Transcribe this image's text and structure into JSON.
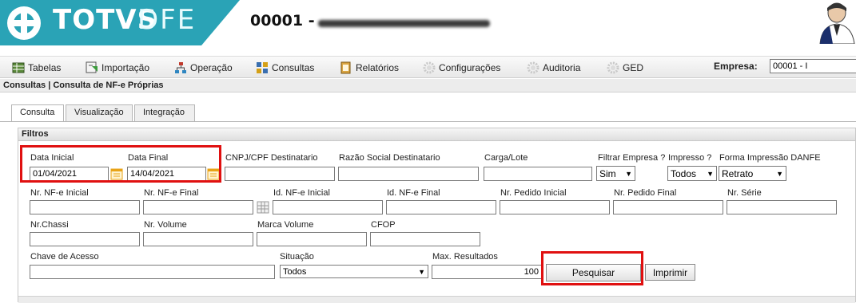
{
  "header": {
    "brand_name": "TOTVS",
    "brand_sub": "DFE",
    "company_title": "00001 - ",
    "brand_color": "#2aa3b6"
  },
  "menu": {
    "items": [
      {
        "label": "Tabelas",
        "icon": "table-icon"
      },
      {
        "label": "Importação",
        "icon": "import-icon"
      },
      {
        "label": "Operação",
        "icon": "operation-icon"
      },
      {
        "label": "Consultas",
        "icon": "grid-icon"
      },
      {
        "label": "Relatórios",
        "icon": "reports-icon"
      },
      {
        "label": "Configurações",
        "icon": "gear-icon"
      },
      {
        "label": "Auditoria",
        "icon": "gear-icon"
      },
      {
        "label": "GED",
        "icon": "gear-icon"
      }
    ],
    "empresa_label": "Empresa:",
    "empresa_value": "00001 - I"
  },
  "breadcrumb": "Consultas | Consulta de NF-e Próprias",
  "tabs": [
    "Consulta",
    "Visualização",
    "Integração"
  ],
  "filters": {
    "title": "Filtros",
    "data_inicial": {
      "label": "Data Inicial",
      "value": "01/04/2021"
    },
    "data_final": {
      "label": "Data Final",
      "value": "14/04/2021"
    },
    "cnpj": {
      "label": "CNPJ/CPF Destinatario",
      "value": ""
    },
    "razao_social": {
      "label": "Razão Social Destinatario",
      "value": ""
    },
    "carga_lote": {
      "label": "Carga/Lote",
      "value": ""
    },
    "filtrar_empresa": {
      "label": "Filtrar Empresa ?",
      "value": "Sim"
    },
    "impresso": {
      "label": "Impresso ?",
      "value": "Todos"
    },
    "forma_impressao": {
      "label": "Forma Impressão DANFE",
      "value": "Retrato"
    },
    "nr_nfe_inicial": {
      "label": "Nr. NF-e Inicial",
      "value": ""
    },
    "nr_nfe_final": {
      "label": "Nr. NF-e Final",
      "value": ""
    },
    "id_nfe_inicial": {
      "label": "Id. NF-e Inicial",
      "value": ""
    },
    "id_nfe_final": {
      "label": "Id. NF-e Final",
      "value": ""
    },
    "nr_pedido_inicial": {
      "label": "Nr. Pedido Inicial",
      "value": ""
    },
    "nr_pedido_final": {
      "label": "Nr. Pedido Final",
      "value": ""
    },
    "nr_serie": {
      "label": "Nr. Série",
      "value": ""
    },
    "nr_chassi": {
      "label": "Nr.Chassi",
      "value": ""
    },
    "nr_volume": {
      "label": "Nr. Volume",
      "value": ""
    },
    "marca_volume": {
      "label": "Marca Volume",
      "value": ""
    },
    "cfop": {
      "label": "CFOP",
      "value": ""
    },
    "chave_acesso": {
      "label": "Chave de Acesso",
      "value": ""
    },
    "situacao": {
      "label": "Situação",
      "value": "Todos"
    },
    "max_resultados": {
      "label": "Max. Resultados",
      "value": "100"
    }
  },
  "buttons": {
    "pesquisar": "Pesquisar",
    "imprimir": "Imprimir"
  },
  "colors": {
    "highlight": "#e01010",
    "calendar": "#e8a317"
  }
}
